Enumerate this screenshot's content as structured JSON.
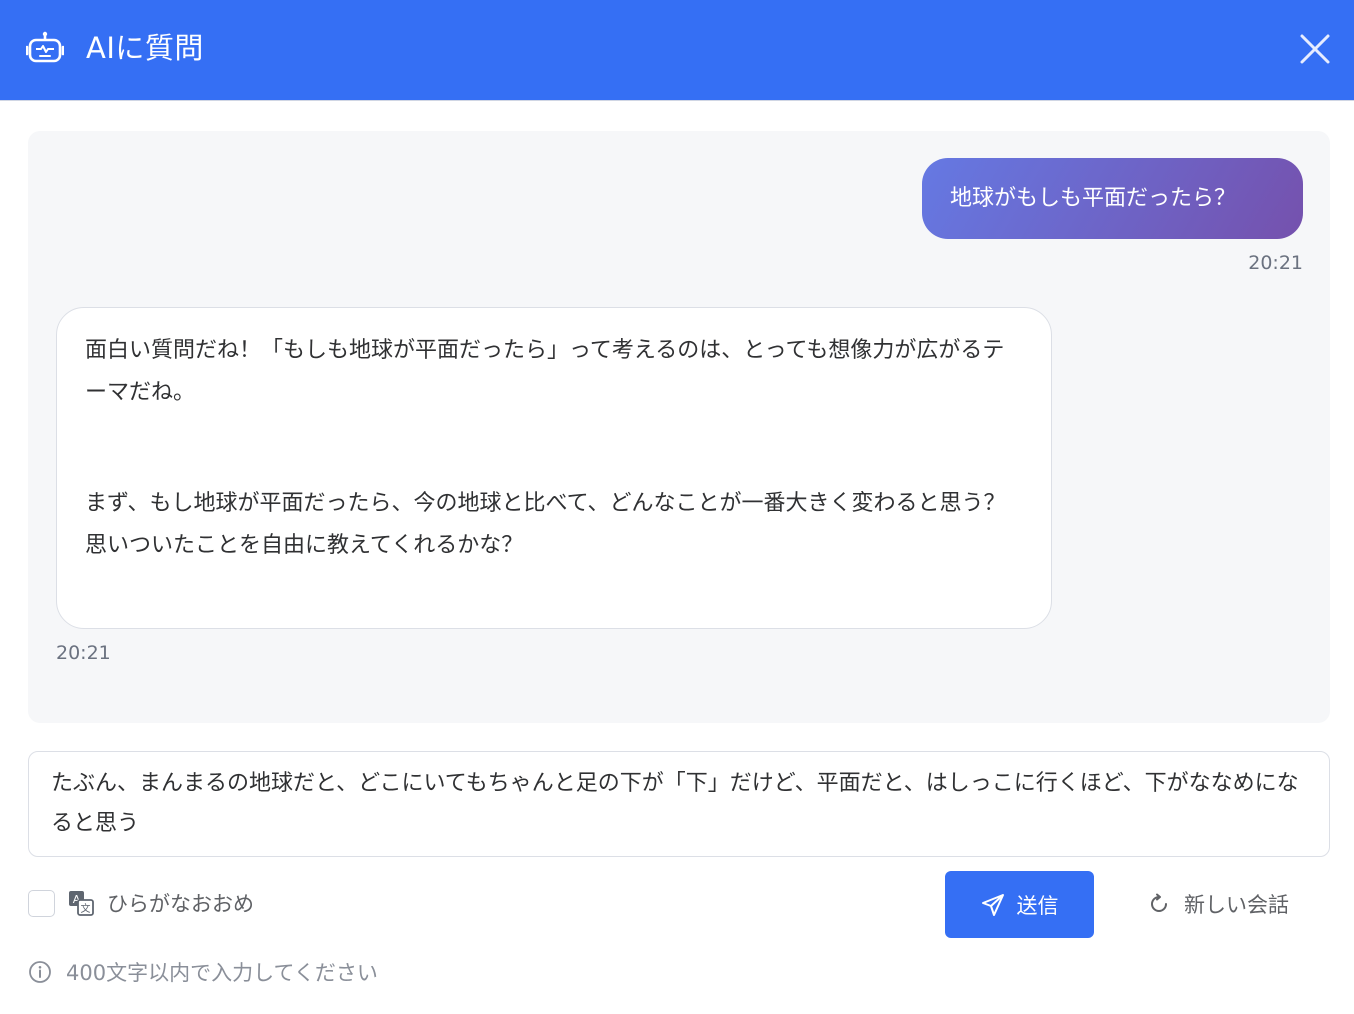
{
  "header": {
    "title": "AIに質問",
    "icon": "robot-icon",
    "close_icon": "close-icon",
    "color": "#356ff4"
  },
  "messages": {
    "user": {
      "text": "地球がもしも平面だったら？",
      "time": "20:21"
    },
    "ai": {
      "paragraph1": "面白い質問だね！「もしも地球が平面だったら」って考えるのは、とっても想像力が広がるテーマだね。",
      "paragraph2": "まず、もし地球が平面だったら、今の地球と比べて、どんなことが一番大きく変わると思う？思いついたことを自由に教えてくれるかな？",
      "time": "20:21"
    }
  },
  "input": {
    "value": "たぶん、まんまるの地球だと、どこにいてもちゃんと足の下が「下」だけど、平面だと、はしっこに行くほど、下がななめになると思う"
  },
  "options": {
    "hiragana_label": "ひらがなおおめ",
    "hiragana_checked": false,
    "icon": "translate-icon"
  },
  "actions": {
    "send_label": "送信",
    "send_icon": "send-icon",
    "new_label": "新しい会話",
    "new_icon": "refresh-icon"
  },
  "hint": {
    "text": "400文字以内で入力してください",
    "icon": "info-icon"
  }
}
